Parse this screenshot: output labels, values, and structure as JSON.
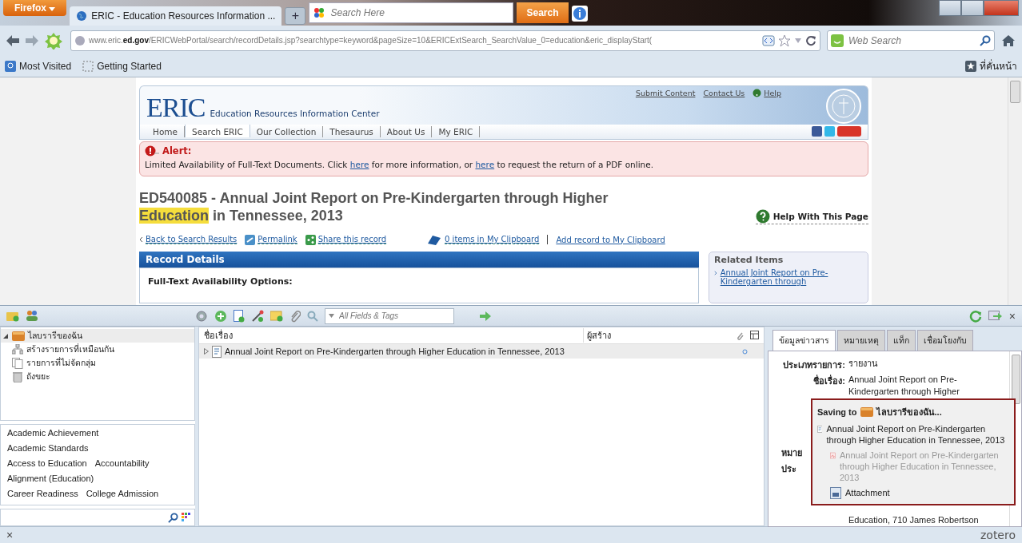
{
  "browser": {
    "menu_button": "Firefox",
    "tabs": [
      {
        "title": "ERIC - Education Resources Information ...",
        "selected": true
      }
    ],
    "new_tab": "+",
    "toolbar_search": {
      "placeholder": "Search Here",
      "button": "Search"
    },
    "url": "www.eric.**ed.gov**/ERICWebPortal/search/recordDetails.jsp?searchtype=keyword&pageSize=10&ERICExtSearch_SearchValue_0=education&eric_displayStart(",
    "web_search": {
      "placeholder": "Web Search"
    },
    "bookmarks": [
      {
        "label": "Most Visited",
        "kind": "smart"
      },
      {
        "label": "Getting Started",
        "kind": "page"
      }
    ],
    "bookmarks_menu": "ที่คั่นหน้า"
  },
  "page": {
    "top_links": [
      "Submit Content",
      "Contact Us",
      "Help"
    ],
    "logo": "ERIC",
    "logo_subtitle": "Education Resources Information Center",
    "nav": [
      {
        "label": "Home",
        "selected": false
      },
      {
        "label": "Search ERIC",
        "selected": true
      },
      {
        "label": "Our Collection",
        "selected": false
      },
      {
        "label": "Thesaurus",
        "selected": false
      },
      {
        "label": "About Us",
        "selected": false
      },
      {
        "label": "My ERIC",
        "selected": false
      }
    ],
    "alert": {
      "title": "Alert:",
      "parts": [
        {
          "kind": "text",
          "text": "Limited Availability of Full-Text Documents. Click "
        },
        {
          "kind": "link",
          "text": "here"
        },
        {
          "kind": "text",
          "text": " for more information, or "
        },
        {
          "kind": "link",
          "text": "here"
        },
        {
          "kind": "text",
          "text": " to request the return of a PDF online."
        }
      ]
    },
    "record_title": [
      {
        "text": "ED540085 - Annual Joint Report on Pre-Kindergarten through Higher ",
        "highlighted": false
      },
      {
        "text": "Education",
        "highlighted": true
      },
      {
        "text": " in Tennessee, 2013",
        "highlighted": false
      }
    ],
    "help_link": "Help With This Page",
    "actions": [
      {
        "label": "Back to Search Results",
        "kind": "back"
      },
      {
        "label": "Permalink",
        "kind": "permalink"
      },
      {
        "label": "Share this record",
        "kind": "share"
      }
    ],
    "clipboard": [
      "0 items in My Clipboard",
      "Add record to My Clipboard"
    ],
    "record_details": {
      "heading": "Record Details",
      "subheading": "Full-Text Availability Options:"
    },
    "related": {
      "heading": "Related Items",
      "items": [
        "Annual Joint Report on Pre-Kindergarten through"
      ]
    }
  },
  "zotero": {
    "search_placeholder": "All Fields & Tags",
    "collections": [
      {
        "label": "ไลบรารีของฉัน",
        "kind": "library",
        "expanded": true,
        "selected": true,
        "children": [
          {
            "label": "สร้างรายการที่เหมือนกัน",
            "kind": "duplicates",
            "selected": false
          },
          {
            "label": "รายการที่ไม่จัดกลุ่ม",
            "kind": "unfiled",
            "selected": false
          },
          {
            "label": "ถังขยะ",
            "kind": "trash",
            "selected": false
          }
        ]
      }
    ],
    "tag_rows": [
      [
        "Academic Achievement"
      ],
      [
        "Academic Standards"
      ],
      [
        "Access to Education",
        "Accountability"
      ],
      [
        "Alignment (Education)"
      ],
      [
        "Career Readiness",
        "College Admission"
      ]
    ],
    "columns": [
      "ชื่อเรื่อง",
      "ผู้สร้าง"
    ],
    "items": [
      {
        "title": "Annual Joint Report on Pre-Kindergarten through Higher Education in Tennessee, 2013",
        "selected": true
      }
    ],
    "info_tabs": [
      {
        "label": "ข้อมูลข่าวสาร",
        "selected": true
      },
      {
        "label": "หมายเหตุ",
        "selected": false
      },
      {
        "label": "แท็ก",
        "selected": false
      },
      {
        "label": "เชื่อมโยงกับ",
        "selected": false
      }
    ],
    "fields": [
      {
        "kind": "full",
        "label": "ประเภทรายการ:",
        "value": "รายงาน"
      },
      {
        "kind": "full",
        "label": "ชื่อเรื่อง:",
        "value": "Annual Joint Report on Pre-Kindergarten through Higher"
      },
      {
        "kind": "cut",
        "label": "หมาย"
      },
      {
        "kind": "cut",
        "label": "ประ"
      },
      {
        "kind": "value",
        "value": "Education, 710 James Robertson"
      }
    ],
    "save_popup": {
      "prefix": "Saving to",
      "library": "ไลบรารีของฉัน...",
      "items": [
        {
          "kind": "item",
          "text": "Annual Joint Report on Pre-Kindergarten through Higher Education in Tennessee, 2013",
          "disabled": false
        },
        {
          "kind": "pdf",
          "text": "Annual Joint Report on Pre-Kindergarten through Higher Education in Tennessee, 2013",
          "disabled": true
        },
        {
          "kind": "attachment",
          "text": "Attachment",
          "disabled": false
        }
      ]
    },
    "close": "×",
    "brand": "zotero"
  }
}
